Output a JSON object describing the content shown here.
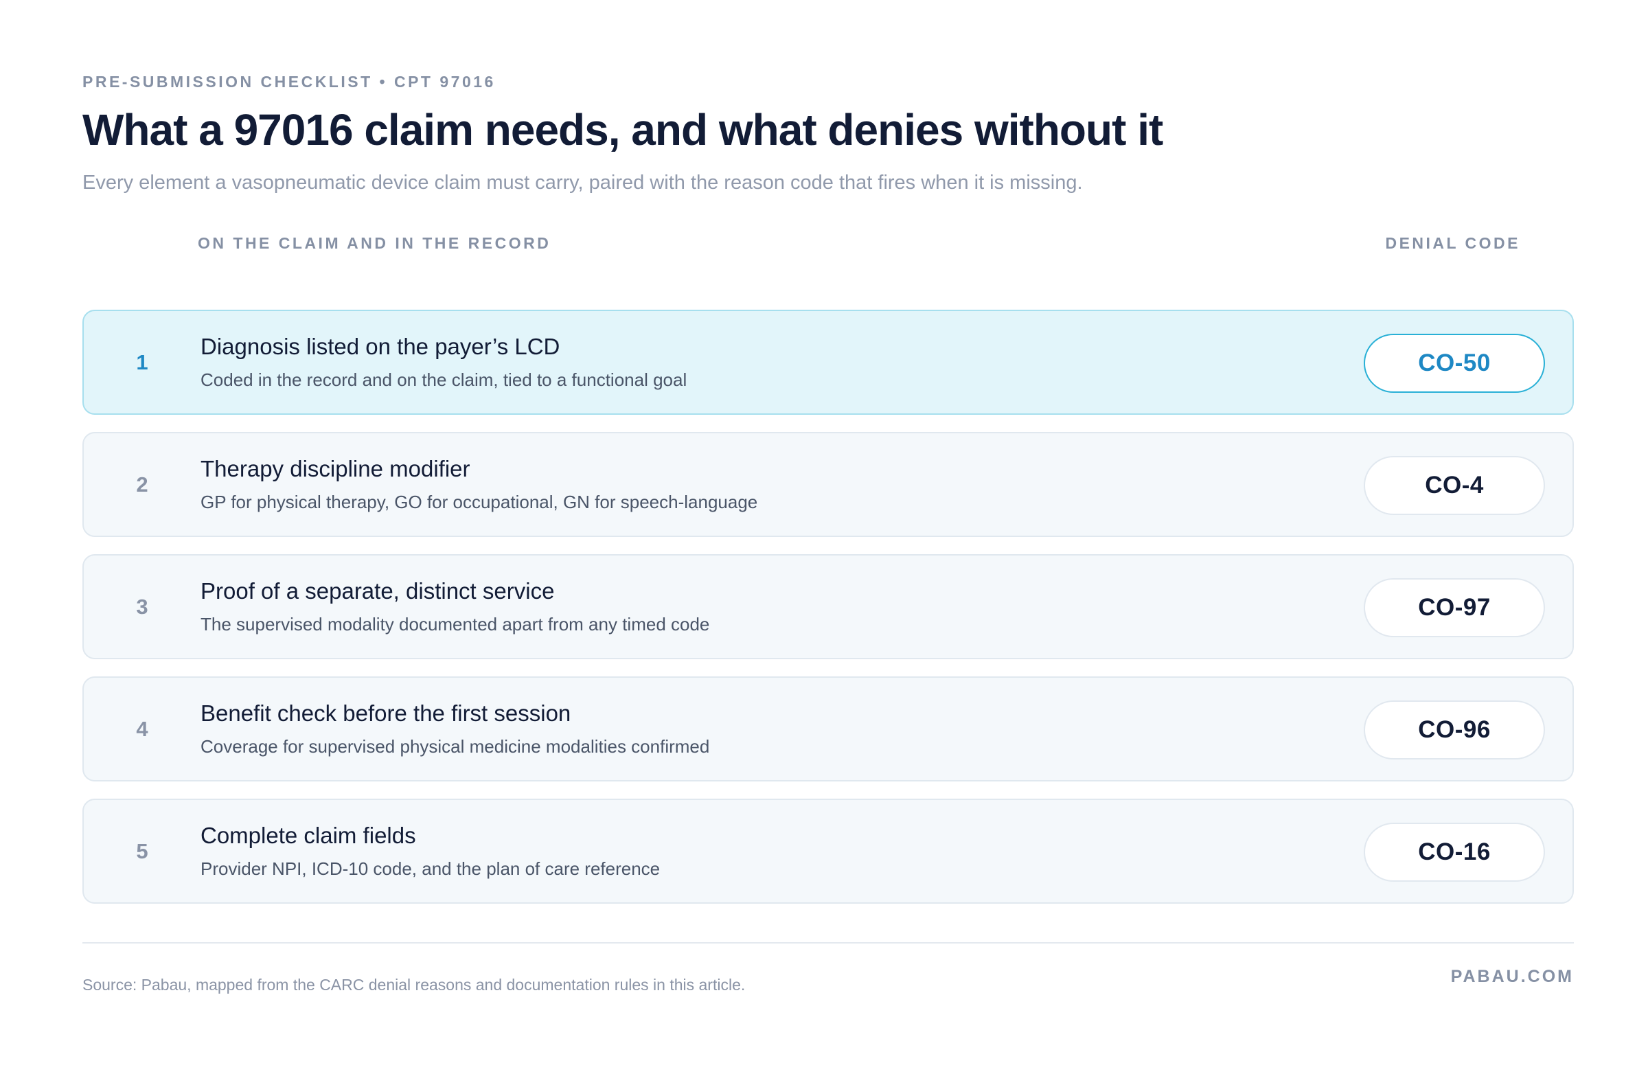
{
  "header": {
    "eyebrow": "PRE-SUBMISSION CHECKLIST • CPT 97016",
    "title": "What a 97016 claim needs, and what denies without it",
    "subtitle": "Every element a vasopneumatic device claim must carry, paired with the reason code that fires when it is missing."
  },
  "columns": {
    "left": "ON THE CLAIM AND IN THE RECORD",
    "right": "DENIAL CODE"
  },
  "rows": [
    {
      "number": "1",
      "title": "Diagnosis listed on the payer’s LCD",
      "description": "Coded in the record and on the claim, tied to a functional goal",
      "code": "CO-50",
      "highlighted": true
    },
    {
      "number": "2",
      "title": "Therapy discipline modifier",
      "description": "GP for physical therapy, GO for occupational, GN for speech-language",
      "code": "CO-4",
      "highlighted": false
    },
    {
      "number": "3",
      "title": "Proof of a separate, distinct service",
      "description": "The supervised modality documented apart from any timed code",
      "code": "CO-97",
      "highlighted": false
    },
    {
      "number": "4",
      "title": "Benefit check before the first session",
      "description": "Coverage for supervised physical medicine modalities confirmed",
      "code": "CO-96",
      "highlighted": false
    },
    {
      "number": "5",
      "title": "Complete claim fields",
      "description": "Provider NPI, ICD-10 code, and the plan of care reference",
      "code": "CO-16",
      "highlighted": false
    }
  ],
  "footer": {
    "source": "Source: Pabau, mapped from the CARC denial reasons and documentation rules in this article.",
    "brand": "PABAU.COM"
  },
  "colors": {
    "title": "#121c36",
    "muted": "#8590a4",
    "accent": "#1e88c4",
    "highlight_bg": "#e2f5fa",
    "row_bg": "#f4f8fb"
  }
}
